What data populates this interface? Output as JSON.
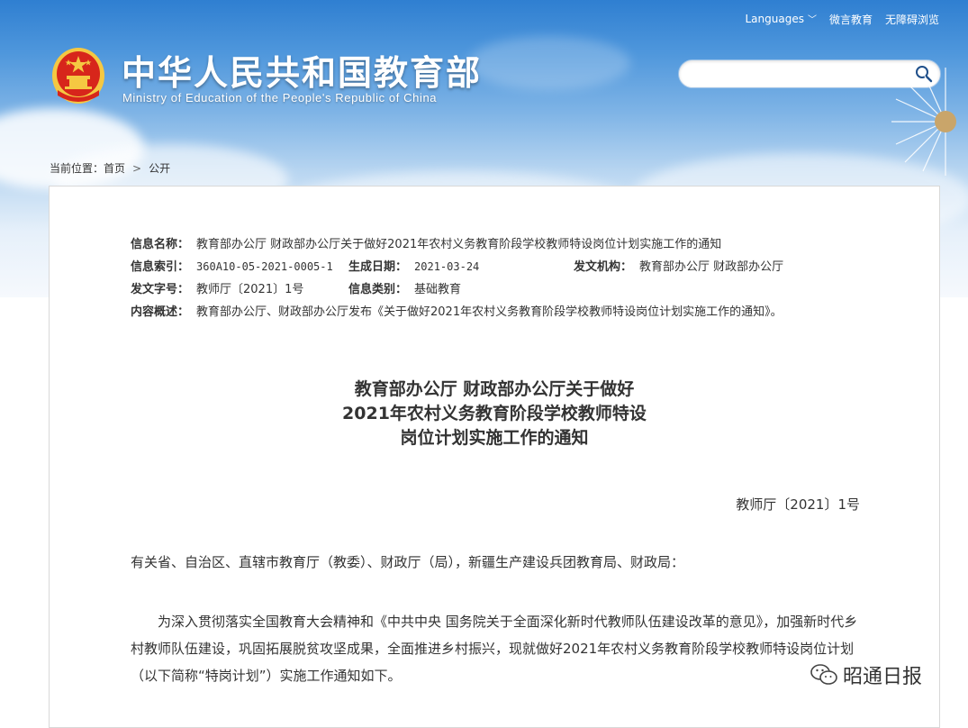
{
  "header": {
    "languages_label": "Languages",
    "weibo_label": "微言教育",
    "accessible_label": "无障碍浏览",
    "site_title": "中华人民共和国教育部",
    "site_subtitle": "Ministry of Education of the People's Republic of China",
    "search_placeholder": ""
  },
  "breadcrumb": {
    "prefix": "当前位置：",
    "home": "首页",
    "current": "公开"
  },
  "meta": {
    "name_label": "信息名称：",
    "name_value": "教育部办公厅 财政部办公厅关于做好2021年农村义务教育阶段学校教师特设岗位计划实施工作的通知",
    "index_label": "信息索引：",
    "index_value": "360A10-05-2021-0005-1",
    "date_label": "生成日期：",
    "date_value": "2021-03-24",
    "org_label": "发文机构：",
    "org_value": "教育部办公厅 财政部办公厅",
    "docno_label": "发文字号：",
    "docno_value": "教师厅〔2021〕1号",
    "category_label": "信息类别：",
    "category_value": "基础教育",
    "summary_label": "内容概述：",
    "summary_value": "教育部办公厅、财政部办公厅发布《关于做好2021年农村义务教育阶段学校教师特设岗位计划实施工作的通知》。"
  },
  "document": {
    "title_line1": "教育部办公厅 财政部办公厅关于做好",
    "title_line2": "2021年农村义务教育阶段学校教师特设",
    "title_line3": "岗位计划实施工作的通知",
    "doc_number": "教师厅〔2021〕1号",
    "salutation": "有关省、自治区、直辖市教育厅（教委）、财政厅（局），新疆生产建设兵团教育局、财政局：",
    "body1": "为深入贯彻落实全国教育大会精神和《中共中央 国务院关于全面深化新时代教师队伍建设改革的意见》，加强新时代乡村教师队伍建设，巩固拓展脱贫攻坚成果，全面推进乡村振兴，现就做好2021年农村义务教育阶段学校教师特设岗位计划（以下简称“特岗计划”）实施工作通知如下。"
  },
  "watermark": {
    "text": "昭通日报"
  },
  "colors": {
    "sky_top": "#2f7fd1",
    "emblem_red": "#d7261b",
    "emblem_gold": "#f5c842"
  },
  "icons": [
    "emblem-icon",
    "search-icon",
    "chevron-down-icon",
    "wechat-icon"
  ]
}
